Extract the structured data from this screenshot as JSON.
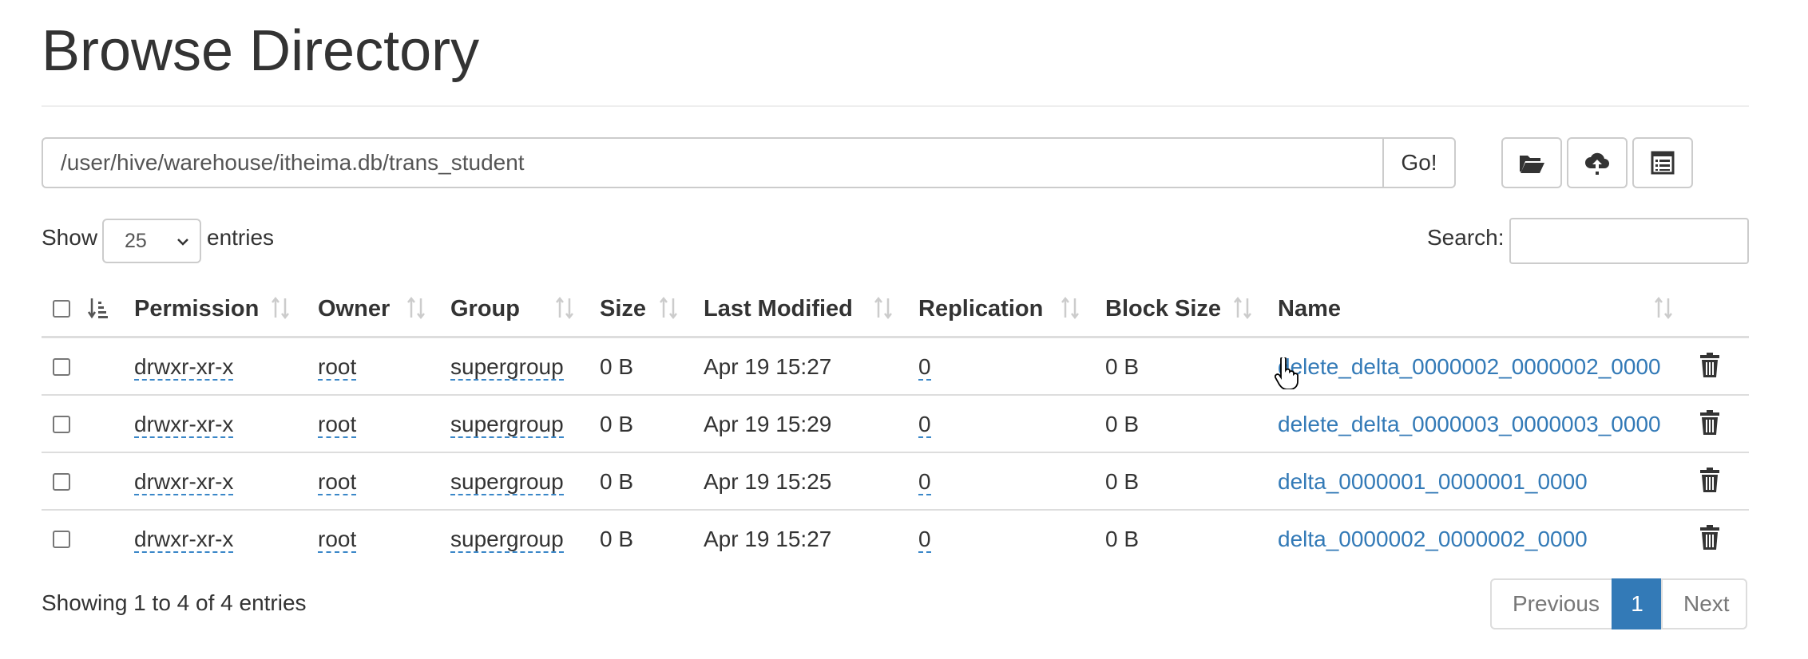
{
  "page": {
    "title": "Browse Directory"
  },
  "pathbar": {
    "path": "/user/hive/warehouse/itheima.db/trans_student",
    "go_label": "Go!",
    "icons": [
      "folder-open-icon",
      "cloud-upload-icon",
      "list-icon"
    ]
  },
  "length": {
    "show_label": "Show",
    "value": "25",
    "entries_label": "entries"
  },
  "search": {
    "label": "Search:",
    "value": ""
  },
  "table": {
    "columns": [
      "Permission",
      "Owner",
      "Group",
      "Size",
      "Last Modified",
      "Replication",
      "Block Size",
      "Name"
    ],
    "rows": [
      {
        "permission": "drwxr-xr-x",
        "owner": "root",
        "group": "supergroup",
        "size": "0 B",
        "modified": "Apr 19 15:27",
        "replication": "0",
        "block_size": "0 B",
        "name": "delete_delta_0000002_0000002_0000"
      },
      {
        "permission": "drwxr-xr-x",
        "owner": "root",
        "group": "supergroup",
        "size": "0 B",
        "modified": "Apr 19 15:29",
        "replication": "0",
        "block_size": "0 B",
        "name": "delete_delta_0000003_0000003_0000"
      },
      {
        "permission": "drwxr-xr-x",
        "owner": "root",
        "group": "supergroup",
        "size": "0 B",
        "modified": "Apr 19 15:25",
        "replication": "0",
        "block_size": "0 B",
        "name": "delta_0000001_0000001_0000"
      },
      {
        "permission": "drwxr-xr-x",
        "owner": "root",
        "group": "supergroup",
        "size": "0 B",
        "modified": "Apr 19 15:27",
        "replication": "0",
        "block_size": "0 B",
        "name": "delta_0000002_0000002_0000"
      }
    ]
  },
  "footer": {
    "info": "Showing 1 to 4 of 4 entries",
    "previous": "Previous",
    "current_page": "1",
    "next": "Next"
  },
  "colors": {
    "link": "#337ab7",
    "active_page": "#337ab7",
    "border": "#dddddd"
  }
}
